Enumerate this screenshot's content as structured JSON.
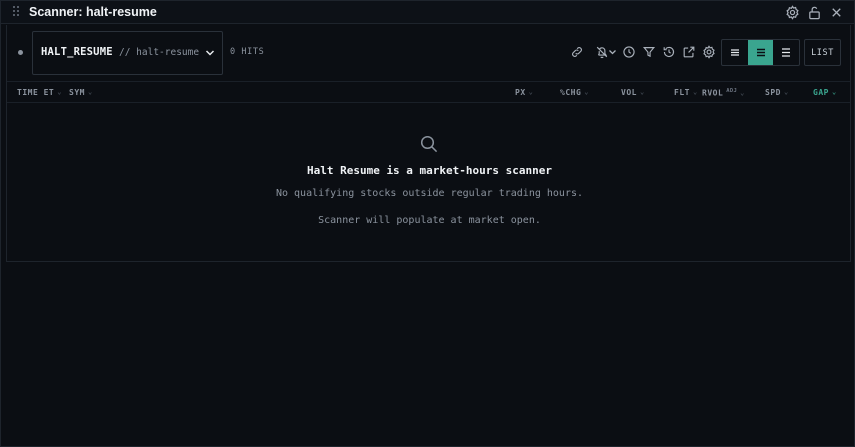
{
  "window": {
    "title": "Scanner: halt-resume",
    "icons": [
      "gear-icon",
      "unlock-icon",
      "close-icon"
    ]
  },
  "toolbar": {
    "scanner_name": "HALT_RESUME",
    "scanner_slug": "// halt-resume",
    "hits": "0 HITS",
    "icons": [
      "link-icon",
      "bell-off-icon",
      "chevron-down-icon",
      "clock-icon",
      "filter-icon",
      "history-icon",
      "external-link-icon",
      "gear-icon"
    ],
    "view_modes": [
      "compact",
      "comfortable",
      "expanded"
    ],
    "active_view": "comfortable",
    "list_label": "LIST"
  },
  "columns": {
    "time": "TIME ET",
    "sym": "SYM",
    "px": "PX",
    "chg": "%CHG",
    "vol": "VOL",
    "flt": "FLT",
    "rvol": "RVOL",
    "rvol_sup": "ADJ",
    "spd": "SPD",
    "gap": "GAP"
  },
  "empty_state": {
    "icon": "search-icon",
    "title": "Halt Resume is a market-hours scanner",
    "line1": "No qualifying stocks outside regular trading hours.",
    "line2": "Scanner will populate at market open."
  },
  "colors": {
    "accent": "#3aa58f",
    "background": "#0b0e13",
    "text_muted": "#8b939e"
  }
}
